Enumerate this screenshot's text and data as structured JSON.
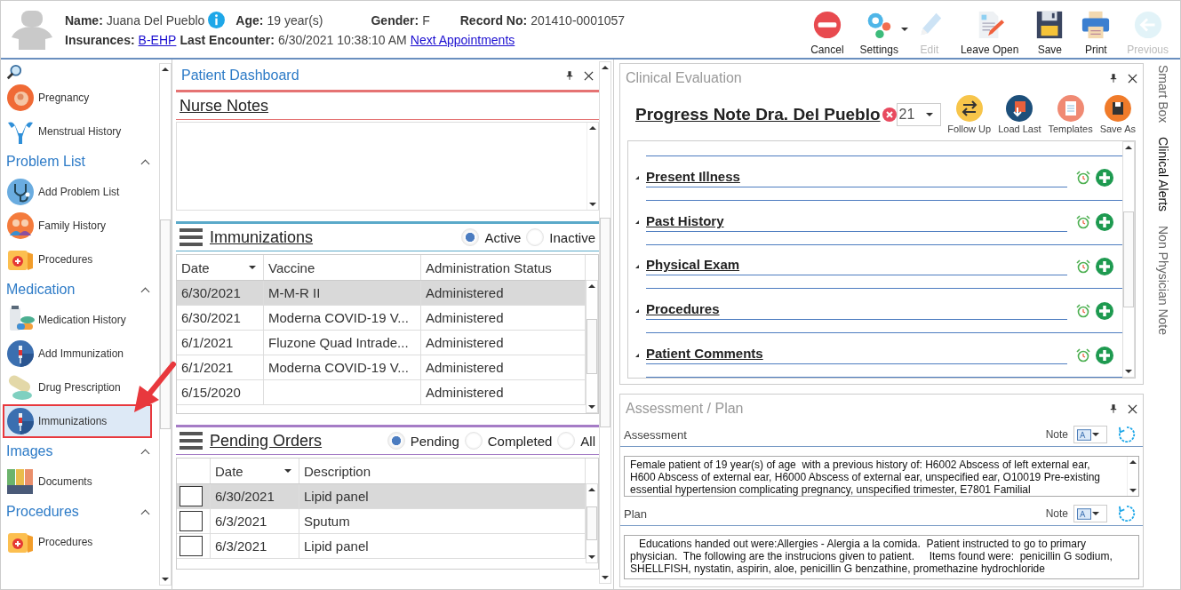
{
  "patient": {
    "name_label": "Name:",
    "name": "Juana Del Pueblo",
    "age_label": "Age:",
    "age": "19 year(s)",
    "gender_label": "Gender:",
    "gender": "F",
    "record_label": "Record No:",
    "record": "201410-0001057",
    "insurances_label": "Insurances:",
    "insurance": "B-EHP",
    "last_encounter_label": "Last Encounter:",
    "last_encounter": "6/30/2021 10:38:10 AM",
    "next_link": "Next Appointments"
  },
  "toolbar": [
    {
      "label": "Cancel",
      "disabled": false
    },
    {
      "label": "Settings",
      "disabled": false
    },
    {
      "label": "Edit",
      "disabled": true
    },
    {
      "label": "Leave Open",
      "disabled": false
    },
    {
      "label": "Save",
      "disabled": false
    },
    {
      "label": "Print",
      "disabled": false
    },
    {
      "label": "Previous",
      "disabled": true
    }
  ],
  "sidebar": {
    "top_items": [
      {
        "label": "Pregnancy",
        "selected": false
      },
      {
        "label": "Menstrual History",
        "selected": false
      }
    ],
    "sections": [
      {
        "title": "Problem List",
        "expanded": true,
        "items": [
          {
            "label": "Add Problem List",
            "selected": false
          },
          {
            "label": "Family History",
            "selected": false
          },
          {
            "label": "Procedures",
            "selected": false
          }
        ]
      },
      {
        "title": "Medication",
        "expanded": true,
        "items": [
          {
            "label": "Medication History",
            "selected": false
          },
          {
            "label": "Add Immunization",
            "selected": false
          },
          {
            "label": "Drug Prescription",
            "selected": false
          },
          {
            "label": "Immunizations",
            "selected": true
          }
        ]
      },
      {
        "title": "Images",
        "expanded": true,
        "items": [
          {
            "label": "Documents",
            "selected": false
          }
        ]
      },
      {
        "title": "Procedures",
        "expanded": true,
        "items": [
          {
            "label": "Procedures",
            "selected": false
          }
        ]
      }
    ]
  },
  "dashboard": {
    "title": "Patient Dashboard",
    "nurse_notes": {
      "title": "Nurse Notes"
    },
    "immunizations": {
      "title": "Immunizations",
      "filters": [
        {
          "label": "Active",
          "selected": true
        },
        {
          "label": "Inactive",
          "selected": false
        }
      ],
      "columns": [
        "Date",
        "Vaccine",
        "Administration Status"
      ],
      "rows": [
        {
          "cells": [
            "6/30/2021",
            "M-M-R II",
            "Administered"
          ],
          "selected": true
        },
        {
          "cells": [
            "6/30/2021",
            "Moderna COVID-19 V...",
            "Administered"
          ],
          "selected": false
        },
        {
          "cells": [
            "6/1/2021",
            "Fluzone Quad Intrade...",
            "Administered"
          ],
          "selected": false
        },
        {
          "cells": [
            "6/1/2021",
            "Moderna COVID-19 V...",
            "Administered"
          ],
          "selected": false
        },
        {
          "cells": [
            "6/15/2020",
            "",
            "Administered"
          ],
          "selected": false
        }
      ]
    },
    "pending_orders": {
      "title": "Pending Orders",
      "filters": [
        {
          "label": "Pending",
          "selected": true
        },
        {
          "label": "Completed",
          "selected": false
        },
        {
          "label": "All",
          "selected": false
        }
      ],
      "columns": [
        "Date",
        "Description"
      ],
      "rows": [
        {
          "cells": [
            "6/30/2021",
            "Lipid panel"
          ],
          "selected": true,
          "checked": false
        },
        {
          "cells": [
            "6/3/2021",
            "Sputum"
          ],
          "selected": false,
          "checked": false
        },
        {
          "cells": [
            "6/3/2021",
            "Lipid panel"
          ],
          "selected": false,
          "checked": false
        }
      ]
    }
  },
  "clinical_evaluation": {
    "title": "Clinical Evaluation",
    "note_title": "Progress Note Dra. Del Pueblo",
    "note_number": "21",
    "actions": [
      "Follow Up",
      "Load Last",
      "Templates",
      "Save As"
    ],
    "sections": [
      {
        "label": "Present Illness",
        "expanded": true
      },
      {
        "label": "Past History",
        "expanded": true
      },
      {
        "label": "Physical Exam",
        "expanded": true
      },
      {
        "label": "Procedures",
        "expanded": true
      },
      {
        "label": "Patient Comments",
        "expanded": true
      }
    ]
  },
  "assessment_plan": {
    "title": "Assessment / Plan",
    "fields": [
      {
        "label": "Assessment",
        "note_label": "Note",
        "lines": [
          "Female patient of 19 year(s) of age  with a previous history of: H6002 Abscess of left external ear,",
          "H600 Abscess of external ear, H6000 Abscess of external ear, unspecified ear, O10019 Pre-existing",
          "essential hypertension complicating pregnancy, unspecified trimester, E7801 Familial"
        ]
      },
      {
        "label": "Plan",
        "note_label": "Note",
        "lines": [
          "   Educations handed out were:Allergies - Alergia a la comida.  Patient instructed to go to primary",
          "physician.  The following are the instrucions given to patient.     Items found were:  penicillin G sodium,",
          "SHELLFISH, nystatin, aspirin, aloe, penicillin G benzathine, promethazine hydrochloride"
        ]
      }
    ]
  },
  "side_tabs": [
    {
      "label": "Smart Box",
      "selected": false
    },
    {
      "label": "Clinical Alerts",
      "selected": true
    },
    {
      "label": "Non Physician Note",
      "selected": false
    }
  ]
}
